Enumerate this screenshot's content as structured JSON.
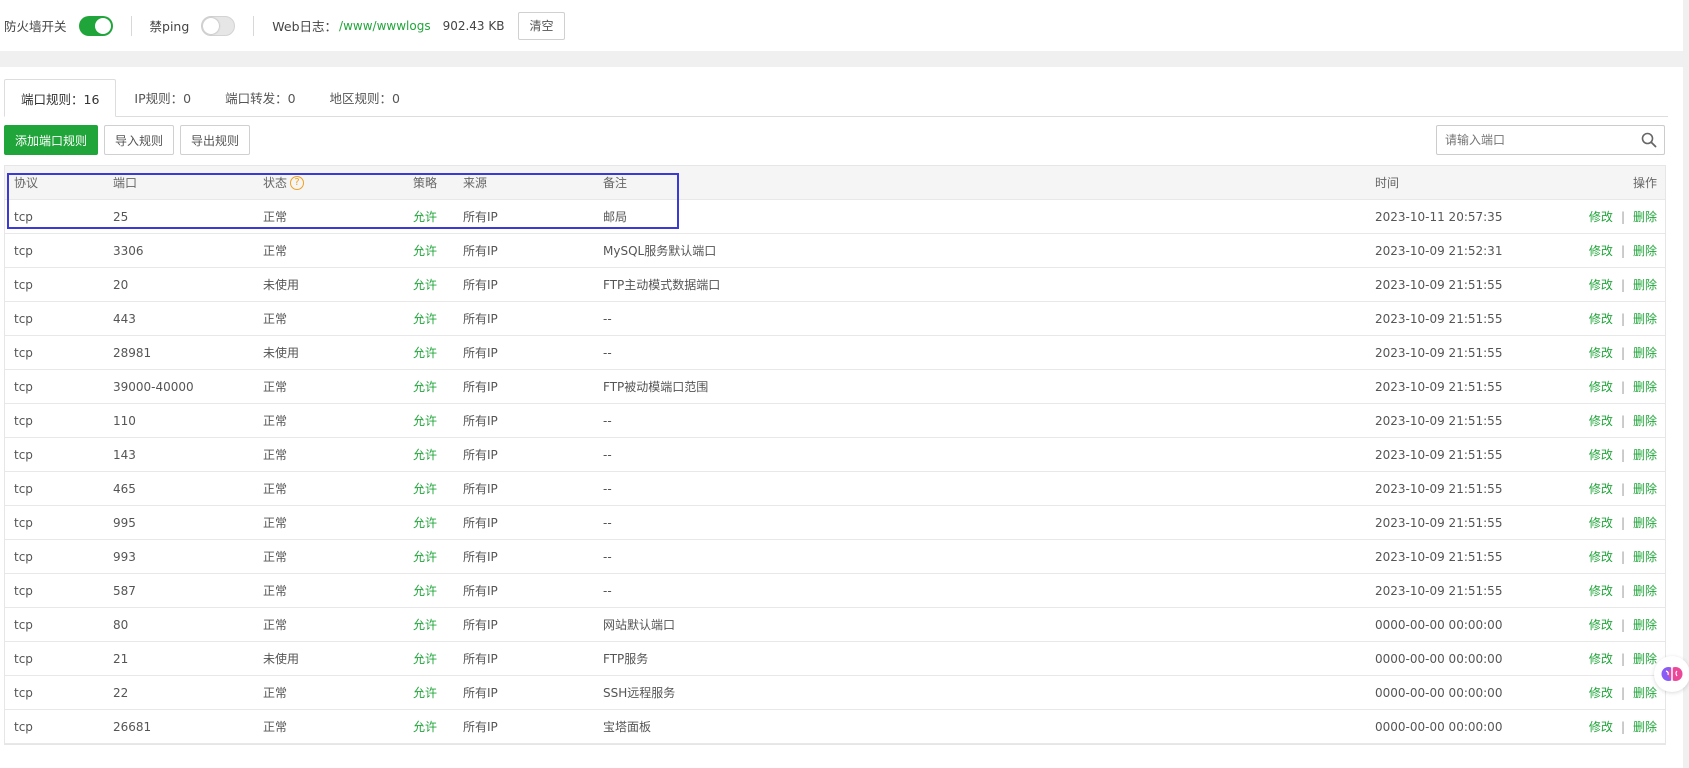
{
  "topbar": {
    "firewall_label": "防火墙开关",
    "firewall_on": true,
    "ping_label": "禁ping",
    "ping_on": false,
    "weblog_label": "Web日志：",
    "weblog_path": "/www/wwwlogs",
    "weblog_size": "902.43 KB",
    "clear_label": "清空"
  },
  "tabs": [
    {
      "label": "端口规则：16",
      "active": true
    },
    {
      "label": "IP规则：0",
      "active": false
    },
    {
      "label": "端口转发：0",
      "active": false
    },
    {
      "label": "地区规则：0",
      "active": false
    }
  ],
  "actions": {
    "add_label": "添加端口规则",
    "import_label": "导入规则",
    "export_label": "导出规则"
  },
  "search": {
    "placeholder": "请输入端口",
    "icon": "search-icon"
  },
  "table": {
    "headers": {
      "protocol": "协议",
      "port": "端口",
      "status": "状态",
      "status_help": "?",
      "policy": "策略",
      "source": "来源",
      "remark": "备注",
      "time": "时间",
      "ops": "操作"
    },
    "op_edit": "修改",
    "op_sep": "|",
    "op_delete": "删除",
    "rows": [
      {
        "protocol": "tcp",
        "port": "25",
        "status": "正常",
        "policy": "允许",
        "source": "所有IP",
        "remark": "邮局",
        "time": "2023-10-11 20:57:35"
      },
      {
        "protocol": "tcp",
        "port": "3306",
        "status": "正常",
        "policy": "允许",
        "source": "所有IP",
        "remark": "MySQL服务默认端口",
        "time": "2023-10-09 21:52:31"
      },
      {
        "protocol": "tcp",
        "port": "20",
        "status": "未使用",
        "policy": "允许",
        "source": "所有IP",
        "remark": "FTP主动模式数据端口",
        "time": "2023-10-09 21:51:55"
      },
      {
        "protocol": "tcp",
        "port": "443",
        "status": "正常",
        "policy": "允许",
        "source": "所有IP",
        "remark": "--",
        "time": "2023-10-09 21:51:55"
      },
      {
        "protocol": "tcp",
        "port": "28981",
        "status": "未使用",
        "policy": "允许",
        "source": "所有IP",
        "remark": "--",
        "time": "2023-10-09 21:51:55"
      },
      {
        "protocol": "tcp",
        "port": "39000-40000",
        "status": "正常",
        "policy": "允许",
        "source": "所有IP",
        "remark": "FTP被动模端口范围",
        "time": "2023-10-09 21:51:55"
      },
      {
        "protocol": "tcp",
        "port": "110",
        "status": "正常",
        "policy": "允许",
        "source": "所有IP",
        "remark": "--",
        "time": "2023-10-09 21:51:55"
      },
      {
        "protocol": "tcp",
        "port": "143",
        "status": "正常",
        "policy": "允许",
        "source": "所有IP",
        "remark": "--",
        "time": "2023-10-09 21:51:55"
      },
      {
        "protocol": "tcp",
        "port": "465",
        "status": "正常",
        "policy": "允许",
        "source": "所有IP",
        "remark": "--",
        "time": "2023-10-09 21:51:55"
      },
      {
        "protocol": "tcp",
        "port": "995",
        "status": "正常",
        "policy": "允许",
        "source": "所有IP",
        "remark": "--",
        "time": "2023-10-09 21:51:55"
      },
      {
        "protocol": "tcp",
        "port": "993",
        "status": "正常",
        "policy": "允许",
        "source": "所有IP",
        "remark": "--",
        "time": "2023-10-09 21:51:55"
      },
      {
        "protocol": "tcp",
        "port": "587",
        "status": "正常",
        "policy": "允许",
        "source": "所有IP",
        "remark": "--",
        "time": "2023-10-09 21:51:55"
      },
      {
        "protocol": "tcp",
        "port": "80",
        "status": "正常",
        "policy": "允许",
        "source": "所有IP",
        "remark": "网站默认端口",
        "time": "0000-00-00 00:00:00"
      },
      {
        "protocol": "tcp",
        "port": "21",
        "status": "未使用",
        "policy": "允许",
        "source": "所有IP",
        "remark": "FTP服务",
        "time": "0000-00-00 00:00:00"
      },
      {
        "protocol": "tcp",
        "port": "22",
        "status": "正常",
        "policy": "允许",
        "source": "所有IP",
        "remark": "SSH远程服务",
        "time": "0000-00-00 00:00:00"
      },
      {
        "protocol": "tcp",
        "port": "26681",
        "status": "正常",
        "policy": "允许",
        "source": "所有IP",
        "remark": "宝塔面板",
        "time": "0000-00-00 00:00:00"
      }
    ]
  },
  "colors": {
    "accent": "#20a53a",
    "highlight": "#3a3ad6",
    "warning": "#f0a020"
  },
  "floating": {
    "icon": "brain-icon"
  }
}
